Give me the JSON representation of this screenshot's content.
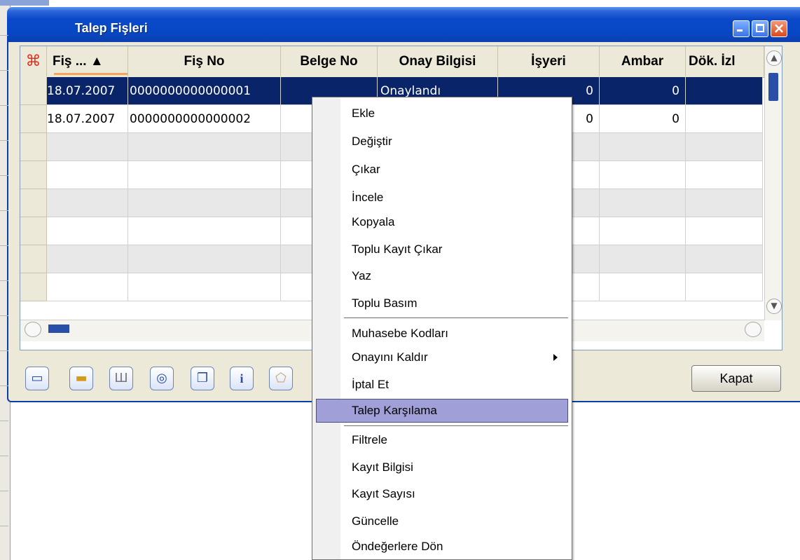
{
  "window": {
    "title": "Talep Fişleri"
  },
  "grid": {
    "columns": [
      "Fiş ... ▲",
      "Fiş No",
      "Belge No",
      "Onay Bilgisi",
      "İşyeri",
      "Ambar",
      "Dök. İzl"
    ],
    "rows": [
      {
        "date": "18.07.2007",
        "fis_no": "0000000000000001",
        "belge_no": "",
        "onay": "Onaylandı",
        "isyeri": "0",
        "ambar": "0"
      },
      {
        "date": "18.07.2007",
        "fis_no": "0000000000000002",
        "belge_no": "",
        "onay": "",
        "isyeri": "0",
        "ambar": "0"
      }
    ]
  },
  "buttons": {
    "close": "Kapat"
  },
  "toolbar_icons": [
    "new-document-icon",
    "open-folder-icon",
    "delete-trash-icon",
    "preview-zoom-icon",
    "copy-document-icon",
    "info-icon",
    "report-icon"
  ],
  "context_menu": {
    "items": [
      "Ekle",
      "Değiştir",
      "Çıkar",
      "İncele",
      "Kopyala",
      "Toplu Kayıt Çıkar",
      "Yaz",
      "Toplu Basım",
      "Muhasebe Kodları",
      "Onayını Kaldır",
      "İptal Et",
      "Talep Karşılama",
      "Filtrele",
      "Kayıt Bilgisi",
      "Kayıt Sayısı",
      "Güncelle",
      "Öndeğerlere Dön"
    ],
    "highlighted": "Talep Karşılama"
  },
  "colors": {
    "titlebar": "#0847c4",
    "selection": "#0a246a",
    "menu_highlight": "#a09fd8"
  }
}
